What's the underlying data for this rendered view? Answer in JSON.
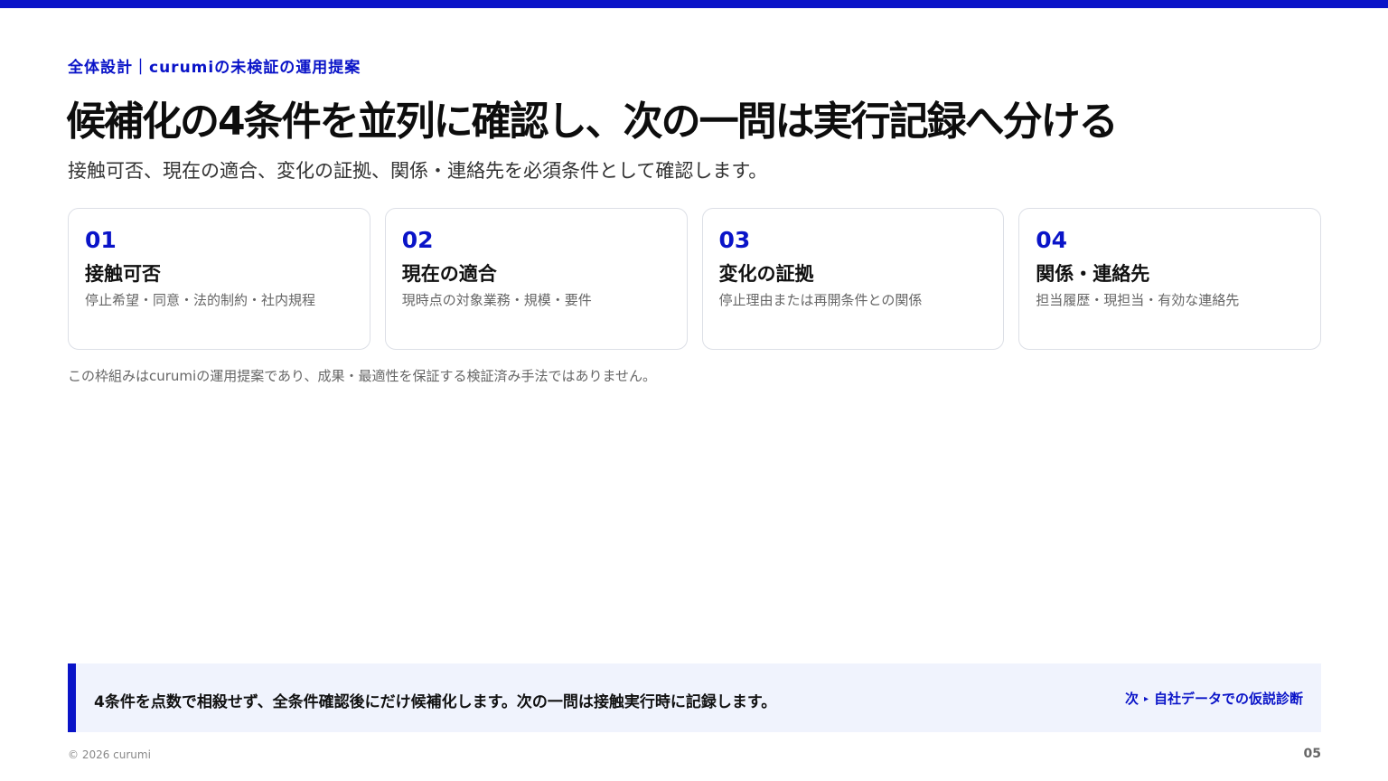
{
  "colors": {
    "accent": "#0a14c8",
    "callout_bg": "#f0f3fd",
    "card_border": "#dcdfe6"
  },
  "header": {
    "eyebrow": "全体設計｜curumiの未検証の運用提案",
    "title": "候補化の4条件を並列に確認し、次の一問は実行記録へ分ける",
    "subtitle": "接触可否、現在の適合、変化の証拠、関係・連絡先を必須条件として確認します。"
  },
  "cards": [
    {
      "num": "01",
      "title": "接触可否",
      "desc": "停止希望・同意・法的制約・社内規程"
    },
    {
      "num": "02",
      "title": "現在の適合",
      "desc": "現時点の対象業務・規模・要件"
    },
    {
      "num": "03",
      "title": "変化の証拠",
      "desc": "停止理由または再開条件との関係"
    },
    {
      "num": "04",
      "title": "関係・連絡先",
      "desc": "担当履歴・現担当・有効な連絡先"
    }
  ],
  "note": "この枠組みはcurumiの運用提案であり、成果・最適性を保証する検証済み手法ではありません。",
  "callout": {
    "text": "4条件を点数で相殺せず、全条件確認後にだけ候補化します。次の一問は接触実行時に記録します。",
    "next_prefix": "次",
    "next_arrow": "▸",
    "next_label": "自社データでの仮説診断"
  },
  "footer": {
    "copyright": "© 2026 curumi",
    "page_number": "05"
  }
}
